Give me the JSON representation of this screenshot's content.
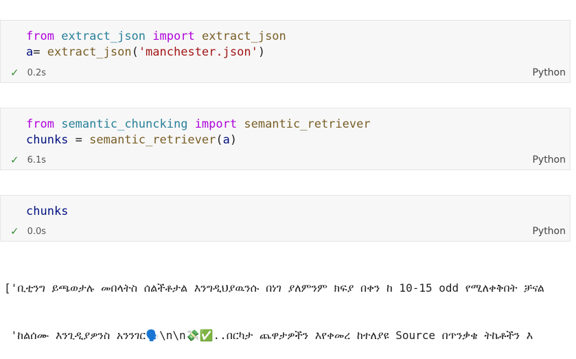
{
  "cells": [
    {
      "line1": {
        "kw1": "from",
        "module": "extract_json",
        "kw2": "import",
        "name": "extract_json"
      },
      "line2": {
        "var": "a",
        "op": "= ",
        "fn": "extract_json",
        "open": "(",
        "str": "'manchester.json'",
        "close": ")"
      },
      "time": "0.2s",
      "language": "Python"
    },
    {
      "line1": {
        "kw1": "from",
        "module": "semantic_chuncking",
        "kw2": "import",
        "name": "semantic_retriever"
      },
      "line2": {
        "var": "chunks",
        "op": " = ",
        "fn": "semantic_retriever",
        "open": "(",
        "arg": "a",
        "close": ")"
      },
      "time": "6.1s",
      "language": "Python"
    },
    {
      "line1": {
        "var": "chunks"
      },
      "time": "0.0s",
      "language": "Python"
    }
  ],
  "output": {
    "line1": "['ቢቲንግ ይጫወታሉ መበላትስ ሰልችቶታል እንግዲህያዉንሱ በነገ ያለምንም ክፍያ በቀን ከ 10-15 odd የሚለቀቅበት ቻናል",
    "line2": " 'ከልሰሙ እንጊዲያዎንስ አንንገር🗣️\\n\\n💸✅..በርካታ ጨዋታዎችን እየቀመረ ከተለያዩ Source በጥንቃቄ ትኬቶችን እ"
  }
}
